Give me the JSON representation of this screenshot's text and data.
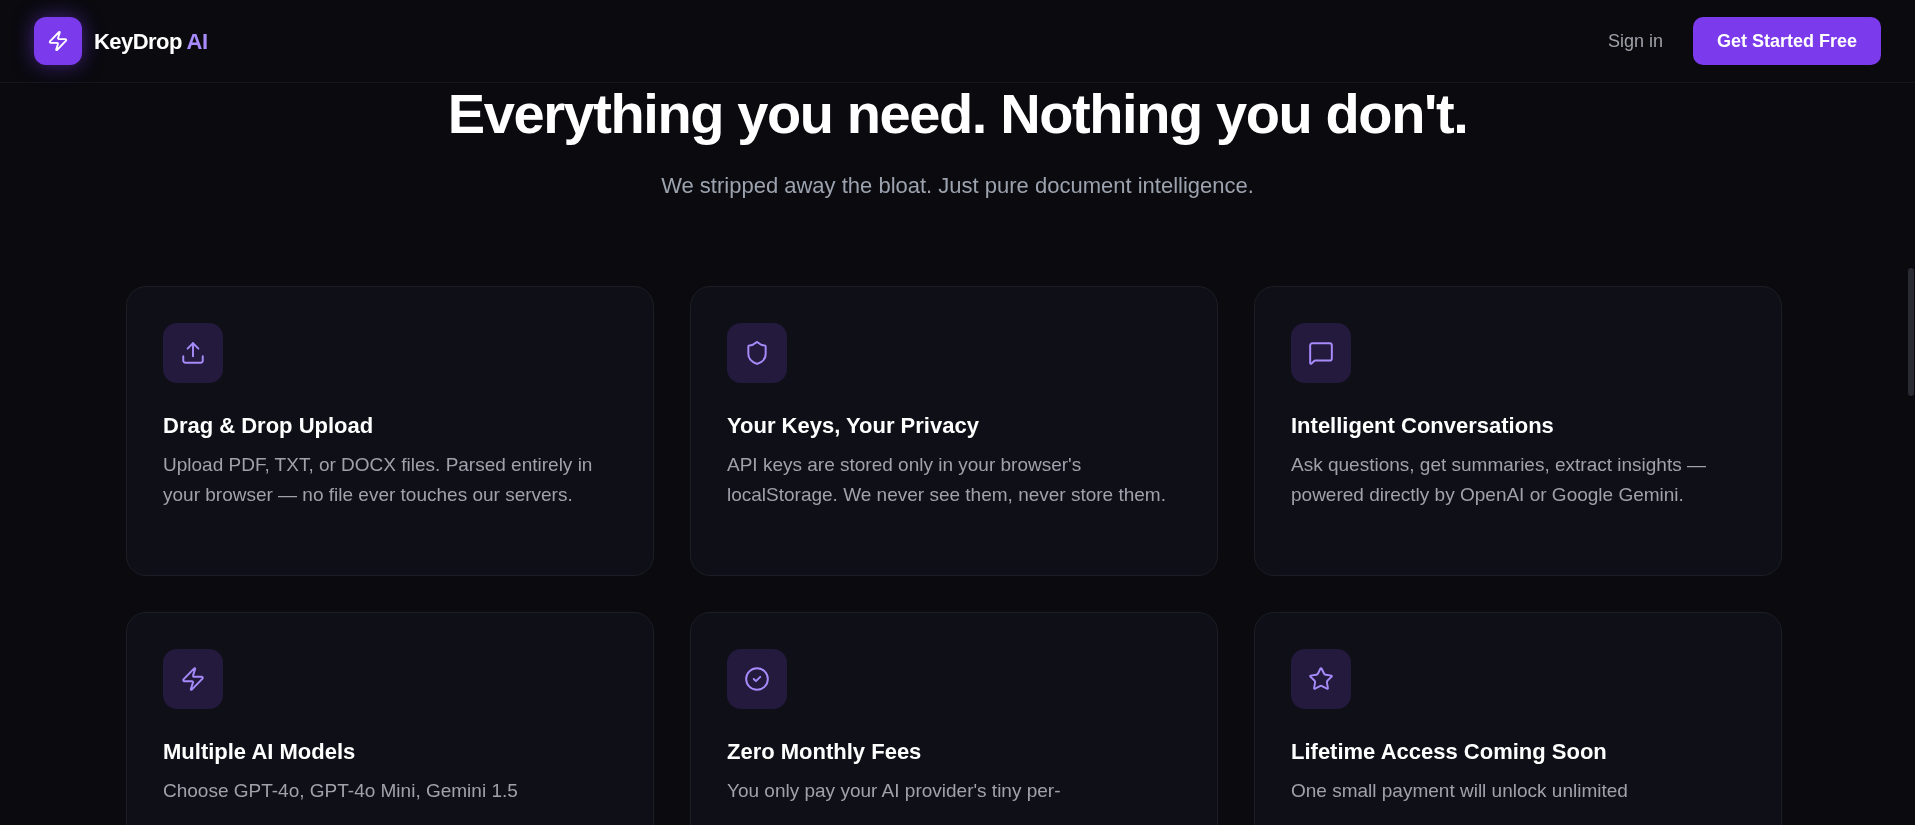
{
  "nav": {
    "brand": "KeyDrop",
    "brand_accent": "AI",
    "sign_in": "Sign in",
    "cta": "Get Started Free"
  },
  "hero": {
    "title": "Everything you need. Nothing you don't.",
    "subtitle": "We stripped away the bloat. Just pure document intelligence."
  },
  "features": [
    {
      "kind": "upload",
      "title": "Drag & Drop Upload",
      "text": "Upload PDF, TXT, or DOCX files. Parsed entirely in your browser — no file ever touches our servers."
    },
    {
      "kind": "shield",
      "title": "Your Keys, Your Privacy",
      "text": "API keys are stored only in your browser's localStorage. We never see them, never store them."
    },
    {
      "kind": "chat",
      "title": "Intelligent Conversations",
      "text": "Ask questions, get summaries, extract insights — powered directly by OpenAI or Google Gemini."
    },
    {
      "kind": "bolt",
      "title": "Multiple AI Models",
      "text": "Choose GPT-4o, GPT-4o Mini, Gemini 1.5"
    },
    {
      "kind": "check",
      "title": "Zero Monthly Fees",
      "text": "You only pay your AI provider's tiny per-"
    },
    {
      "kind": "star",
      "title": "Lifetime Access Coming Soon",
      "text": "One small payment will unlock unlimited"
    }
  ]
}
